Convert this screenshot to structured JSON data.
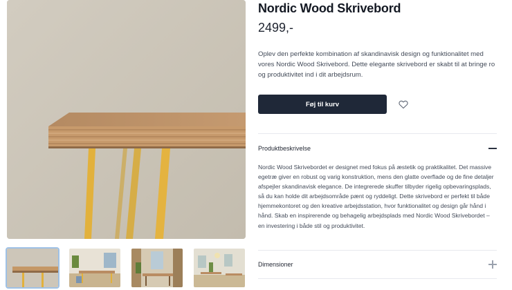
{
  "product": {
    "title": "Nordic Wood Skrivebord",
    "price": "2499,-",
    "lead": "Oplev den perfekte kombination af skandinavisk design og funktionalitet med vores Nordic Wood Skrivebord. Dette elegante skrivebord er skabt til at bringe ro og produktivitet ind i dit arbejdsrum."
  },
  "actions": {
    "add_to_cart_label": "Føj til kurv",
    "wishlist_icon": "heart-icon"
  },
  "gallery": {
    "main_image": "desk-closeup-photo",
    "thumbnails": [
      {
        "name": "desk-closeup-thumb",
        "selected": true
      },
      {
        "name": "room-window-thumb",
        "selected": false
      },
      {
        "name": "dining-room-thumb",
        "selected": false
      },
      {
        "name": "cafe-room-thumb",
        "selected": false
      }
    ]
  },
  "accordion": {
    "description": {
      "title": "Produktbeskrivelse",
      "expanded": true,
      "icon": "minus-icon",
      "body": "Nordic Wood Skrivebordet er designet med fokus på æstetik og praktikalitet. Det massive egetræ giver en robust og varig konstruktion, mens den glatte overflade og de fine detaljer afspejler skandinavisk elegance. De integrerede skuffer tilbyder rigelig opbevaringsplads, så du kan holde dit arbejdsområde pænt og ryddeligt. Dette skrivebord er perfekt til både hjemmekontoret og den kreative arbejdsstation, hvor funktionalitet og design går hånd i hånd. Skab en inspirerende og behagelig arbejdsplads med Nordic Wood Skrivebordet – en investering i både stil og produktivitet."
    },
    "dimensions": {
      "title": "Dimensioner",
      "expanded": false,
      "icon": "plus-icon"
    }
  },
  "colors": {
    "button": "#1f2838",
    "leg": "#e2b13c",
    "wood": "#b98c62",
    "selected_thumb_border": "#9ec1e6"
  }
}
